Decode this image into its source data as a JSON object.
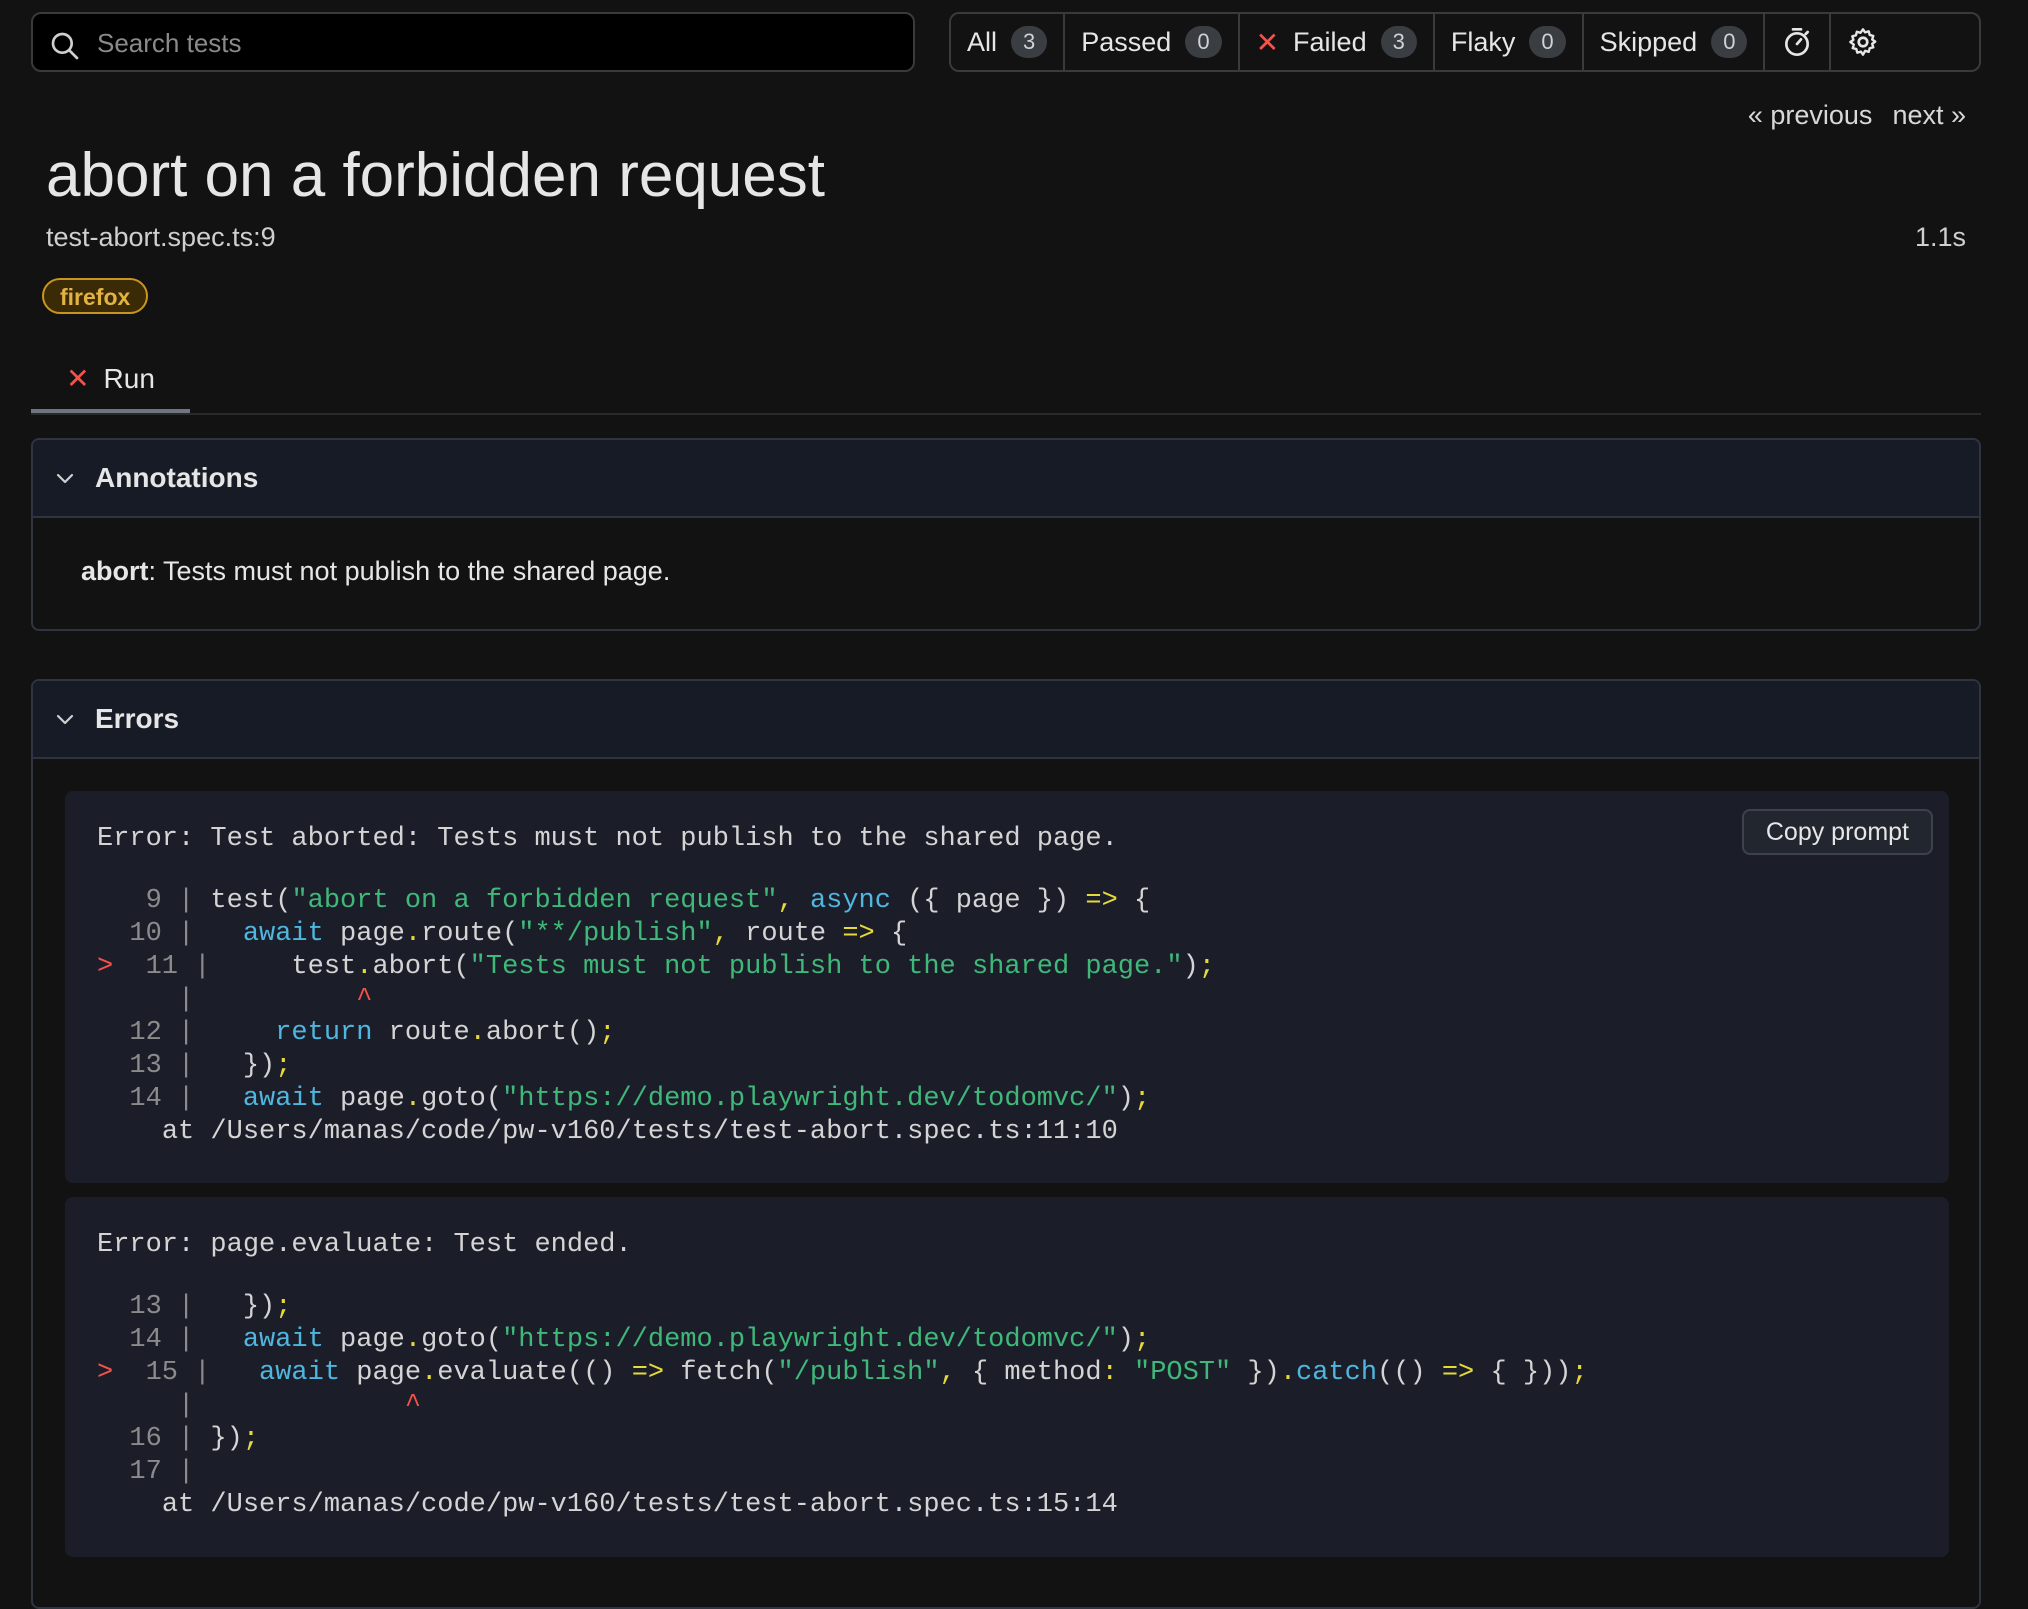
{
  "search": {
    "placeholder": "Search tests"
  },
  "filters": [
    {
      "label": "All",
      "count": "3"
    },
    {
      "label": "Passed",
      "count": "0"
    },
    {
      "label": "Failed",
      "count": "3"
    },
    {
      "label": "Flaky",
      "count": "0"
    },
    {
      "label": "Skipped",
      "count": "0"
    }
  ],
  "nav": {
    "previous": "« previous",
    "next": "next »"
  },
  "test": {
    "title": "abort on a forbidden request",
    "location": "test-abort.spec.ts:9",
    "duration": "1.1s",
    "project": "firefox"
  },
  "tab": {
    "label": "Run"
  },
  "annotations": {
    "heading": "Annotations",
    "type": "abort",
    "description": ": Tests must not publish to the shared page."
  },
  "errors": {
    "heading": "Errors",
    "copy_label": "Copy prompt",
    "items": [
      {
        "message": "Error: Test aborted: Tests must not publish to the shared page.",
        "at": "at /Users/manas/code/pw-v160/tests/test-abort.spec.ts:11:10"
      },
      {
        "message": "Error: page.evaluate: Test ended.",
        "at": "at /Users/manas/code/pw-v160/tests/test-abort.spec.ts:15:14"
      }
    ]
  },
  "icons": {
    "search": "search-icon",
    "failed": "x-icon",
    "timer": "stopwatch-icon",
    "settings": "gear-icon",
    "collapse": "chevron-down-icon"
  },
  "colors": {
    "failed": "#f85149",
    "badge_text": "#e3b341",
    "keyword": "#4fb6e0",
    "string": "#3fb87a",
    "punctuation": "#e6d93a"
  }
}
